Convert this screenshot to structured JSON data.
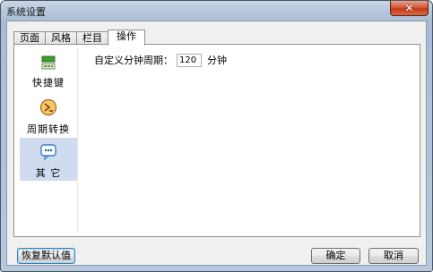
{
  "window": {
    "title": "系统设置",
    "close_symbol": "✕"
  },
  "tabs": [
    {
      "label": "页面",
      "active": false
    },
    {
      "label": "风格",
      "active": false
    },
    {
      "label": "栏目",
      "active": false
    },
    {
      "label": "操作",
      "active": true
    }
  ],
  "sidebar": {
    "items": [
      {
        "label": "快捷键",
        "icon": "keyboard-icon",
        "selected": false
      },
      {
        "label": "周期转换",
        "icon": "cycle-convert-icon",
        "selected": false
      },
      {
        "label": "其 它",
        "icon": "chat-bubble-icon",
        "selected": true
      }
    ]
  },
  "settings": {
    "period_label": "自定义分钟周期：",
    "period_value": "120",
    "period_unit": "分钟"
  },
  "buttons": {
    "reset": "恢复默认值",
    "ok": "确定",
    "cancel": "取消"
  },
  "colors": {
    "selected_item_bg": "#cfdcef",
    "close_button": "#c23b1d",
    "frame": "#b6c7db"
  }
}
